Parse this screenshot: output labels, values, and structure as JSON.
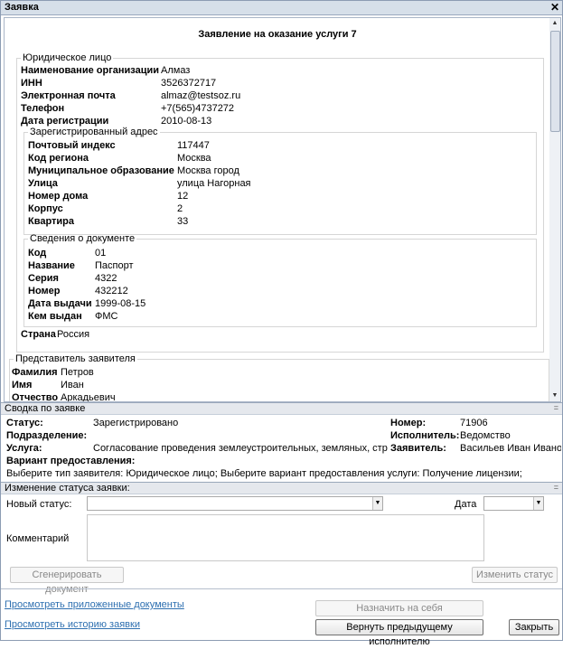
{
  "window": {
    "title": "Заявка",
    "close_glyph": "✕"
  },
  "document": {
    "title": "Заявление на оказание услуги 7",
    "legal_entity": {
      "legend": "Юридическое лицо",
      "fields": [
        {
          "k": "Наименование организации",
          "v": "Алмаз"
        },
        {
          "k": "ИНН",
          "v": "3526372717"
        },
        {
          "k": "Электронная почта",
          "v": "almaz@testsoz.ru"
        },
        {
          "k": "Телефон",
          "v": "+7(565)4737272"
        },
        {
          "k": "Дата регистрации",
          "v": "2010-08-13"
        }
      ],
      "country_label": "Страна",
      "country_value": "Россия"
    },
    "address": {
      "legend": "Зарегистрированный адрес",
      "fields": [
        {
          "k": "Почтовый индекс",
          "v": "117447"
        },
        {
          "k": "Код региона",
          "v": "Москва"
        },
        {
          "k": "Муниципальное образование",
          "v": "Москва город"
        },
        {
          "k": "Улица",
          "v": "улица Нагорная"
        },
        {
          "k": "Номер дома",
          "v": "12"
        },
        {
          "k": "Корпус",
          "v": "2"
        },
        {
          "k": "Квартира",
          "v": "33"
        }
      ]
    },
    "id_document": {
      "legend": "Сведения о документе",
      "fields": [
        {
          "k": "Код",
          "v": "01"
        },
        {
          "k": "Название",
          "v": "Паспорт"
        },
        {
          "k": "Серия",
          "v": "4322"
        },
        {
          "k": "Номер",
          "v": "432212"
        },
        {
          "k": "Дата выдачи",
          "v": "1999-08-15"
        },
        {
          "k": "Кем выдан",
          "v": "ФМС"
        }
      ]
    },
    "representative": {
      "legend": "Представитель заявителя",
      "fields": [
        {
          "k": "Фамилия",
          "v": "Петров"
        },
        {
          "k": "Имя",
          "v": "Иван"
        },
        {
          "k": "Отчество",
          "v": "Аркадьевич"
        }
      ]
    }
  },
  "summary": {
    "header": "Сводка по заявке",
    "status_label": "Статус:",
    "status_value": "Зарегистрировано",
    "number_label": "Номер:",
    "number_value": "71906",
    "department_label": "Подразделение:",
    "executor_label": "Исполнитель:",
    "executor_value": "Ведомство",
    "service_label": "Услуга:",
    "service_value": "Согласование проведения землеустроительных, земляных, строи",
    "applicant_label": "Заявитель:",
    "applicant_value": "Васильев Иван Иванов",
    "variant_label": "Вариант предоставления:",
    "variant_value": "Выберите тип заявителя: Юридическое лицо; Выберите вариант предоставления услуги: Получение лицензии;"
  },
  "status_change": {
    "header": "Изменение статуса заявки:",
    "new_status_label": "Новый статус:",
    "new_status_value": "",
    "date_label": "Дата",
    "date_value": "",
    "comment_label": "Комментарий",
    "generate_button": "Сгенерировать документ",
    "change_button": "Изменить статус"
  },
  "footer": {
    "view_documents_link": "Просмотреть приложенные документы",
    "view_history_link": "Просмотреть историю заявки",
    "assign_button": "Назначить на себя",
    "return_button": "Вернуть предыдущему исполнителю",
    "close_button": "Закрыть"
  }
}
